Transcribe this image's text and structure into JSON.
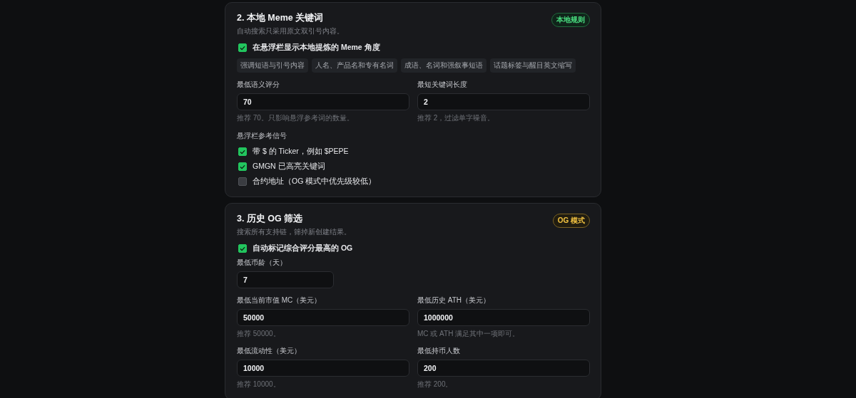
{
  "cards": [
    {
      "title": "2. 本地 Meme 关键词",
      "description": "自动搜索只采用原文双引号内容。",
      "badge": {
        "text": "本地规则",
        "kind": "green"
      },
      "items": [
        {
          "kind": "main_checkbox",
          "label": "在悬浮栏显示本地提炼的 Meme 角度",
          "checked": true
        },
        {
          "kind": "chips",
          "chips": [
            "强调短语与引号内容",
            "人名、产品名和专有名词",
            "成语、名词和强叙事短语",
            "话题标签与醒目英文缩写"
          ]
        },
        {
          "kind": "fields",
          "fields": [
            {
              "label": "最低语义评分",
              "value": "70",
              "hint": "推荐 70。只影响悬浮参考词的数量。"
            },
            {
              "label": "最短关键词长度",
              "value": "2",
              "hint": "推荐 2，过滤单字噪音。"
            }
          ]
        },
        {
          "kind": "heading",
          "text": "悬浮栏参考信号"
        },
        {
          "kind": "checkbox",
          "label": "带 $ 的 Ticker，例如 $PEPE",
          "checked": true
        },
        {
          "kind": "checkbox",
          "label": "GMGN 已高亮关键词",
          "checked": true
        },
        {
          "kind": "checkbox",
          "label": "合约地址（OG 模式中优先级较低）",
          "checked": false
        }
      ]
    },
    {
      "title": "3. 历史 OG 筛选",
      "description": "搜索所有支持链，筛掉新创建结果。",
      "badge": {
        "text": "OG 模式",
        "kind": "gold"
      },
      "items": [
        {
          "kind": "main_checkbox",
          "label": "自动标记综合评分最高的 OG",
          "checked": true
        },
        {
          "kind": "short_field",
          "label": "最低币龄（天）",
          "value": "7"
        },
        {
          "kind": "fields",
          "fields": [
            {
              "label": "最低当前市值 MC（美元）",
              "value": "50000",
              "hint": "推荐 50000。"
            },
            {
              "label": "最低历史 ATH（美元）",
              "value": "1000000",
              "hint": "MC 或 ATH 满足其中一项即可。"
            }
          ]
        },
        {
          "kind": "fields",
          "fields": [
            {
              "label": "最低流动性（美元）",
              "value": "10000",
              "hint": "推荐 10000。"
            },
            {
              "label": "最低持币人数",
              "value": "200",
              "hint": "推荐 200。"
            }
          ]
        }
      ]
    }
  ]
}
